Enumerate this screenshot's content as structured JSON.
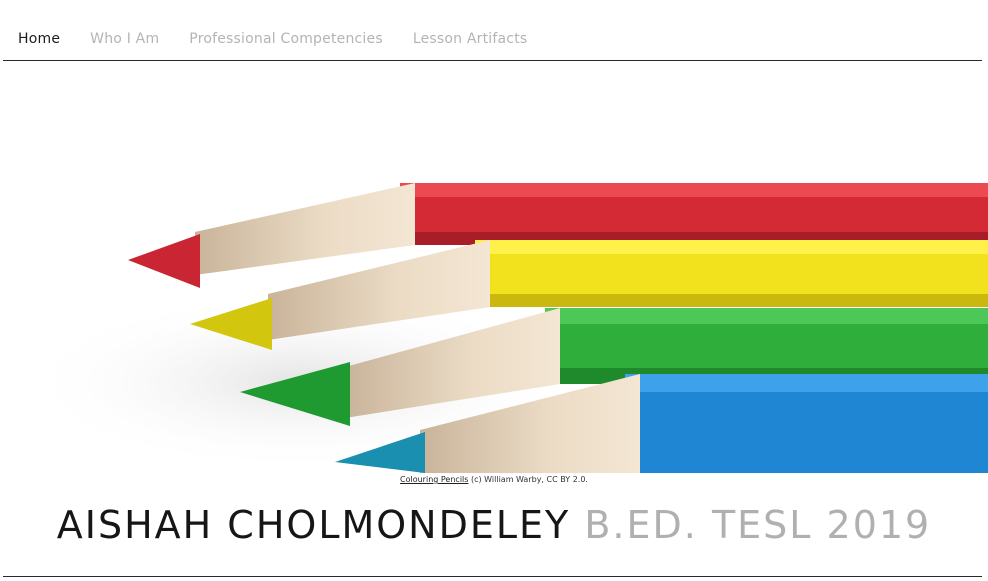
{
  "nav": {
    "items": [
      {
        "label": "Home",
        "active": true
      },
      {
        "label": "Who I Am",
        "active": false
      },
      {
        "label": "Professional Competencies",
        "active": false
      },
      {
        "label": "Lesson Artifacts",
        "active": false
      }
    ]
  },
  "hero": {
    "caption_link": "Colouring Pencils",
    "caption_text": " (c) William Warby, CC BY 2.0.",
    "pencil_colors": [
      "#d42a35",
      "#f2e21e",
      "#2fae3c",
      "#1f86d4"
    ]
  },
  "title": {
    "name": "AISHAH CHOLMONDELEY",
    "degree": " B.ED. TESL 2019"
  },
  "colors": {
    "nav_active": "#1c1c1c",
    "nav_inactive": "#b4b4b4",
    "title_dark": "#161616",
    "title_light": "#b0b0b0"
  }
}
